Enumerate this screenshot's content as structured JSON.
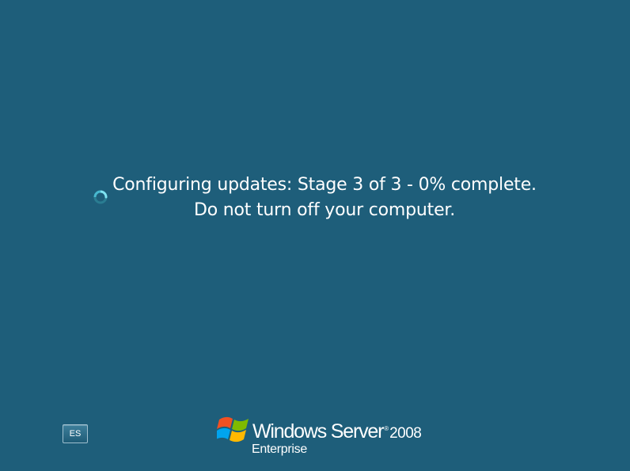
{
  "status": {
    "line1": "Configuring updates: Stage 3 of 3 - 0% complete.",
    "line2": "Do not turn off your computer.",
    "stage_current": 3,
    "stage_total": 3,
    "percent_complete": 0
  },
  "spinner_icon": "loading-spinner-icon",
  "language_button": {
    "label": "ES"
  },
  "branding": {
    "logo_icon": "windows-flag-icon",
    "product_name": "Windows Server",
    "trademark": "®",
    "version": "2008",
    "edition": "Enterprise"
  },
  "colors": {
    "background": "#1e5e7a",
    "text": "#ffffff",
    "spinner": "#5fd3e6"
  }
}
